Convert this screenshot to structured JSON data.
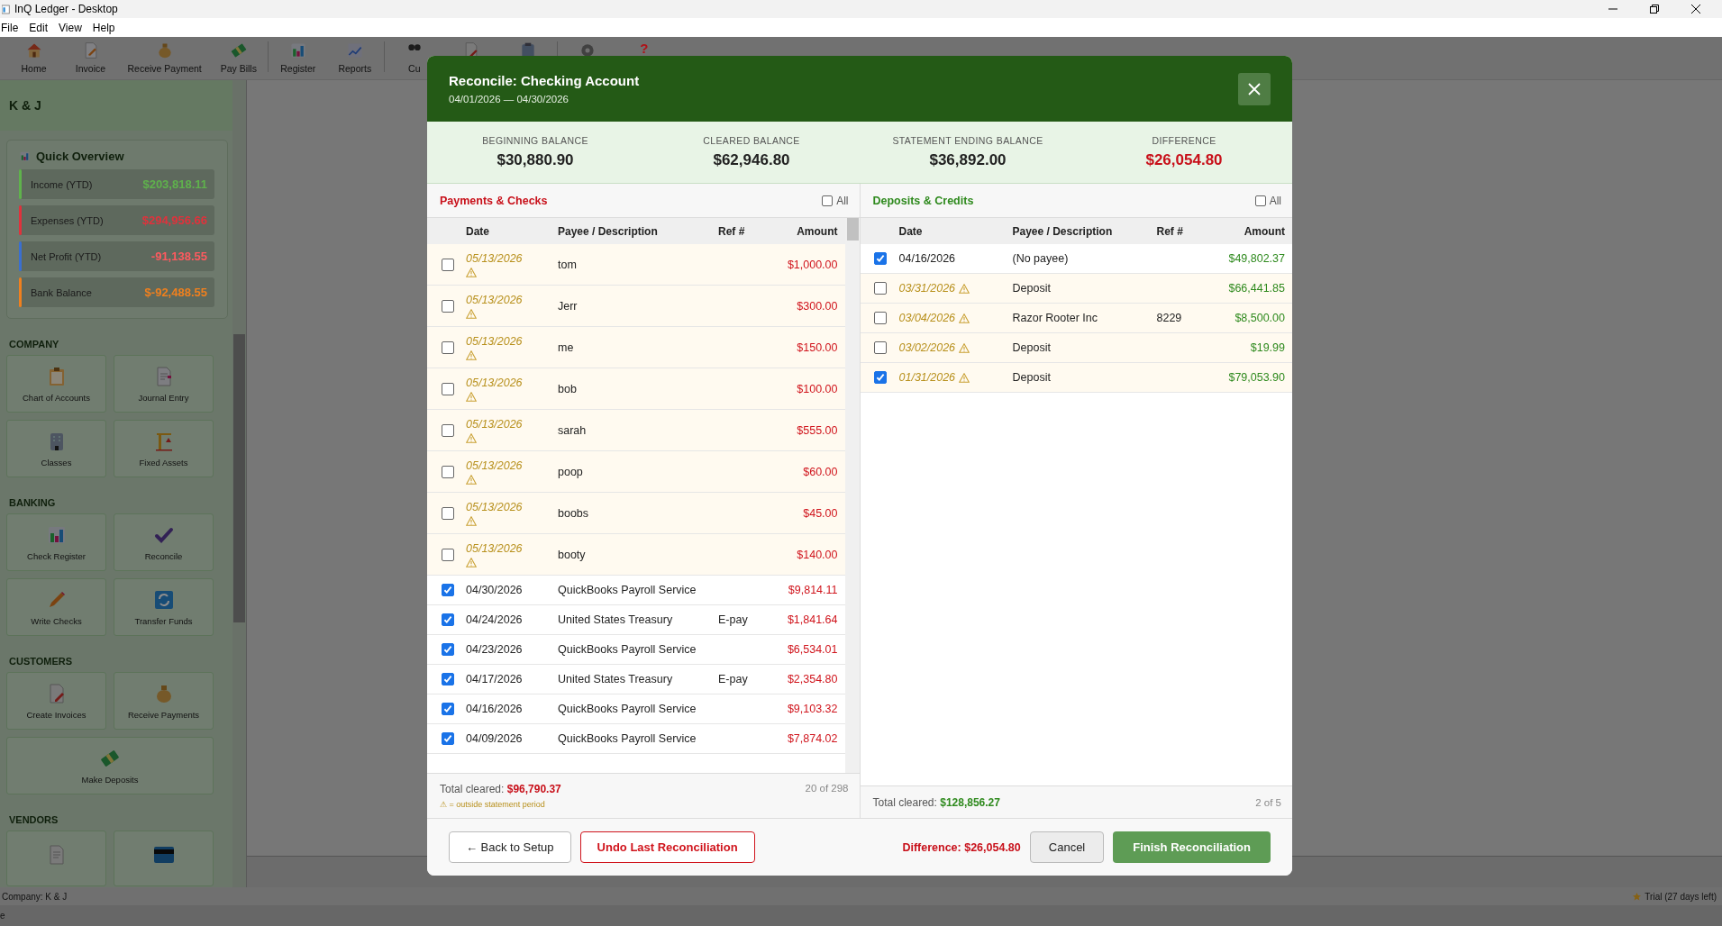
{
  "window": {
    "title": "InQ Ledger - Desktop"
  },
  "menu": [
    "File",
    "Edit",
    "View",
    "Help"
  ],
  "toolbar": [
    {
      "label": "Home"
    },
    {
      "label": "Invoice"
    },
    {
      "label": "Receive Payment"
    },
    {
      "label": "Pay Bills"
    },
    {
      "kind": "separator"
    },
    {
      "label": "Register"
    },
    {
      "label": "Reports"
    },
    {
      "kind": "separator"
    },
    {
      "label": "Cu"
    },
    {
      "kind": "icon"
    },
    {
      "kind": "icon"
    },
    {
      "kind": "separator"
    },
    {
      "kind": "icon"
    },
    {
      "glyph": "?"
    }
  ],
  "sidebar": {
    "company": "K & J",
    "overview": {
      "title": "Quick Overview",
      "stats": [
        {
          "label": "Income (YTD)",
          "value": "$203,818.11",
          "color": "#5fb24c",
          "alert": false
        },
        {
          "label": "Expenses (YTD)",
          "value": "$294,956.66",
          "color": "#e0323c",
          "alert": false
        },
        {
          "label": "Net Profit (YTD)",
          "value": "-91,138.55",
          "color": "#3a6fd0",
          "alert": true
        },
        {
          "label": "Bank Balance",
          "value": "$-92,488.55",
          "color": "#f0801e",
          "alert": false
        }
      ]
    },
    "sections": [
      {
        "title": "COMPANY",
        "items": [
          {
            "label": "Chart of Accounts"
          },
          {
            "label": "Journal Entry"
          },
          {
            "label": "Classes"
          },
          {
            "label": "Fixed Assets"
          }
        ]
      },
      {
        "title": "BANKING",
        "items": [
          {
            "label": "Check Register"
          },
          {
            "label": "Reconcile"
          },
          {
            "label": "Write Checks"
          },
          {
            "label": "Transfer Funds"
          }
        ]
      },
      {
        "title": "CUSTOMERS",
        "items": [
          {
            "label": "Create Invoices"
          },
          {
            "label": "Receive Payments"
          },
          {
            "label": "Make Deposits",
            "wide": true
          }
        ]
      },
      {
        "title": "VENDORS",
        "items": [
          {
            "kind": "cut"
          },
          {
            "kind": "cut"
          }
        ]
      }
    ]
  },
  "status_bar": {
    "company": "Company: K & J",
    "trial": "Trial (27 days left)",
    "second_line": "e"
  },
  "dialog": {
    "title": "Reconcile: Checking Account",
    "period": "04/01/2026 — 04/30/2026",
    "summary": [
      {
        "label": "BEGINNING BALANCE",
        "value": "$30,880.90",
        "alert": false
      },
      {
        "label": "CLEARED BALANCE",
        "value": "$62,946.80",
        "alert": false
      },
      {
        "label": "STATEMENT ENDING BALANCE",
        "value": "$36,892.00",
        "alert": false
      },
      {
        "label": "DIFFERENCE",
        "value": "$26,054.80",
        "alert": true
      }
    ],
    "panels": [
      {
        "kind": "payments",
        "title": "Payments & Checks",
        "all_label": "All",
        "all_checked": false,
        "columns": [
          "Date",
          "Payee / Description",
          "Ref #",
          "Amount"
        ],
        "rows": [
          {
            "checked": false,
            "date": "05/13/2026",
            "payee": "tom",
            "ref": "",
            "amount": "$1,000.00",
            "outside": true
          },
          {
            "checked": false,
            "date": "05/13/2026",
            "payee": "Jerr",
            "ref": "",
            "amount": "$300.00",
            "outside": true
          },
          {
            "checked": false,
            "date": "05/13/2026",
            "payee": "me",
            "ref": "",
            "amount": "$150.00",
            "outside": true
          },
          {
            "checked": false,
            "date": "05/13/2026",
            "payee": "bob",
            "ref": "",
            "amount": "$100.00",
            "outside": true
          },
          {
            "checked": false,
            "date": "05/13/2026",
            "payee": "sarah",
            "ref": "",
            "amount": "$555.00",
            "outside": true
          },
          {
            "checked": false,
            "date": "05/13/2026",
            "payee": "poop",
            "ref": "",
            "amount": "$60.00",
            "outside": true
          },
          {
            "checked": false,
            "date": "05/13/2026",
            "payee": "boobs",
            "ref": "",
            "amount": "$45.00",
            "outside": true
          },
          {
            "checked": false,
            "date": "05/13/2026",
            "payee": "booty",
            "ref": "",
            "amount": "$140.00",
            "outside": true
          },
          {
            "checked": true,
            "date": "04/30/2026",
            "payee": "QuickBooks Payroll Service",
            "ref": "",
            "amount": "$9,814.11",
            "outside": false
          },
          {
            "checked": true,
            "date": "04/24/2026",
            "payee": "United States Treasury",
            "ref": "E-pay",
            "amount": "$1,841.64",
            "outside": false
          },
          {
            "checked": true,
            "date": "04/23/2026",
            "payee": "QuickBooks Payroll Service",
            "ref": "",
            "amount": "$6,534.01",
            "outside": false
          },
          {
            "checked": true,
            "date": "04/17/2026",
            "payee": "United States Treasury",
            "ref": "E-pay",
            "amount": "$2,354.80",
            "outside": false
          },
          {
            "checked": true,
            "date": "04/16/2026",
            "payee": "QuickBooks Payroll Service",
            "ref": "",
            "amount": "$9,103.32",
            "outside": false
          },
          {
            "checked": true,
            "date": "04/09/2026",
            "payee": "QuickBooks Payroll Service",
            "ref": "",
            "amount": "$7,874.02",
            "outside": false
          }
        ],
        "total_label": "Total cleared:",
        "total": "$96,790.37",
        "count": "20 of 298",
        "legend": "⚠ = outside statement period"
      },
      {
        "kind": "deposits",
        "title": "Deposits & Credits",
        "all_label": "All",
        "all_checked": false,
        "columns": [
          "Date",
          "Payee / Description",
          "Ref #",
          "Amount"
        ],
        "rows": [
          {
            "checked": true,
            "date": "04/16/2026",
            "payee": "(No payee)",
            "ref": "",
            "amount": "$49,802.37",
            "outside": false
          },
          {
            "checked": false,
            "date": "03/31/2026",
            "payee": "Deposit",
            "ref": "",
            "amount": "$66,441.85",
            "outside": true
          },
          {
            "checked": false,
            "date": "03/04/2026",
            "payee": "Razor Rooter Inc",
            "ref": "8229",
            "amount": "$8,500.00",
            "outside": true
          },
          {
            "checked": false,
            "date": "03/02/2026",
            "payee": "Deposit",
            "ref": "",
            "amount": "$19.99",
            "outside": true
          },
          {
            "checked": true,
            "date": "01/31/2026",
            "payee": "Deposit",
            "ref": "",
            "amount": "$79,053.90",
            "outside": true
          }
        ],
        "total_label": "Total cleared:",
        "total": "$128,856.27",
        "count": "2 of 5"
      }
    ],
    "footer": {
      "back": "← Back to Setup",
      "undo": "Undo Last Reconciliation",
      "difference": "Difference: $26,054.80",
      "cancel": "Cancel",
      "finish": "Finish Reconciliation"
    }
  }
}
